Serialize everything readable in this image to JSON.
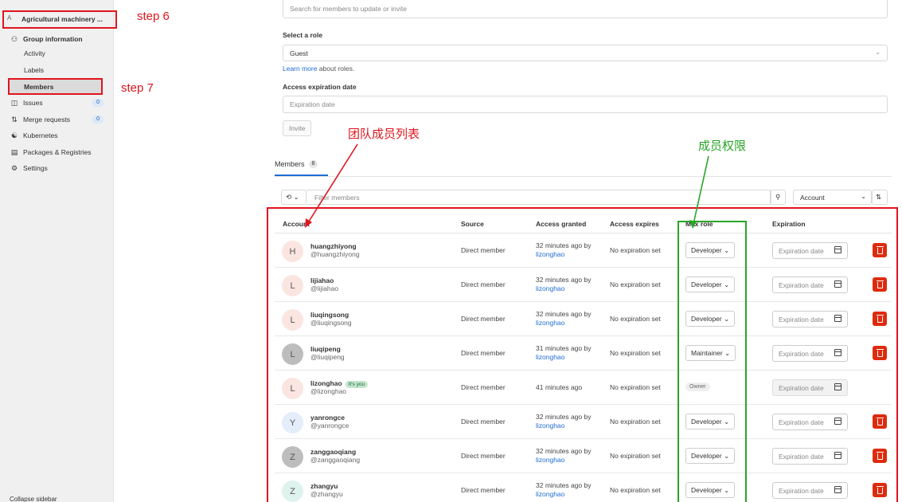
{
  "sidebar": {
    "header_letter": "A",
    "header_title": "Agricultural machinery ...",
    "group_info": "Group information",
    "activity": "Activity",
    "labels": "Labels",
    "members": "Members",
    "issues": "Issues",
    "issues_count": "0",
    "merge_requests": "Merge requests",
    "merge_requests_count": "0",
    "kubernetes": "Kubernetes",
    "packages": "Packages & Registries",
    "settings": "Settings",
    "collapse": "Collapse sidebar"
  },
  "annotations": {
    "step6": "step 6",
    "step7": "step  7",
    "members_list": "团队成员列表",
    "member_perms": "成员权限"
  },
  "form": {
    "search_placeholder": "Search for members to update or invite",
    "role_label": "Select a role",
    "role_value": "Guest",
    "learn_more_link": "Learn more",
    "learn_more_rest": " about roles.",
    "exp_label": "Access expiration date",
    "exp_placeholder": "Expiration date",
    "invite_button": "Invite"
  },
  "tabs": {
    "members_label": "Members",
    "members_count": "8"
  },
  "filter": {
    "placeholder": "Filter members",
    "sort_value": "Account"
  },
  "table": {
    "headers": [
      "Account",
      "Source",
      "Access granted",
      "Access expires",
      "Max role",
      "Expiration"
    ],
    "rows": [
      {
        "initial": "H",
        "name": "huangzhiyong",
        "handle": "@huangzhiyong",
        "source": "Direct member",
        "granted": "32 minutes ago by",
        "granted_by": "lizonghao",
        "expires": "No expiration set",
        "role": "Developer",
        "exp": "Expiration date"
      },
      {
        "initial": "L",
        "name": "lijiahao",
        "handle": "@lijiahao",
        "source": "Direct member",
        "granted": "32 minutes ago by",
        "granted_by": "lizonghao",
        "expires": "No expiration set",
        "role": "Developer",
        "exp": "Expiration date"
      },
      {
        "initial": "L",
        "name": "liuqingsong",
        "handle": "@liuqingsong",
        "source": "Direct member",
        "granted": "32 minutes ago by",
        "granted_by": "lizonghao",
        "expires": "No expiration set",
        "role": "Developer",
        "exp": "Expiration date"
      },
      {
        "initial": "L",
        "name": "liuqipeng",
        "handle": "@liuqipeng",
        "source": "Direct member",
        "granted": "31 minutes ago by",
        "granted_by": "lizonghao",
        "expires": "No expiration set",
        "role": "Maintainer",
        "exp": "Expiration date"
      },
      {
        "initial": "L",
        "name": "lizonghao",
        "badge": "It's you",
        "handle": "@lizonghao",
        "source": "Direct member",
        "granted": "41 minutes ago",
        "granted_by": "",
        "expires": "No expiration set",
        "role": "Owner",
        "exp": "Expiration date"
      },
      {
        "initial": "Y",
        "name": "yanrongce",
        "handle": "@yanrongce",
        "source": "Direct member",
        "granted": "32 minutes ago by",
        "granted_by": "lizonghao",
        "expires": "No expiration set",
        "role": "Developer",
        "exp": "Expiration date"
      },
      {
        "initial": "Z",
        "name": "zanggaoqiang",
        "handle": "@zanggaoqiang",
        "source": "Direct member",
        "granted": "32 minutes ago by",
        "granted_by": "lizonghao",
        "expires": "No expiration set",
        "role": "Developer",
        "exp": "Expiration date"
      },
      {
        "initial": "Z",
        "name": "zhangyu",
        "handle": "@zhangyu",
        "source": "Direct member",
        "granted": "32 minutes ago by",
        "granted_by": "lizonghao",
        "expires": "No expiration set",
        "role": "Developer",
        "exp": "Expiration date"
      }
    ]
  },
  "colors": {
    "annotation_red": "#e0141e",
    "annotation_green": "#27a627",
    "danger": "#dd2b0e",
    "link": "#1f6cd4"
  }
}
